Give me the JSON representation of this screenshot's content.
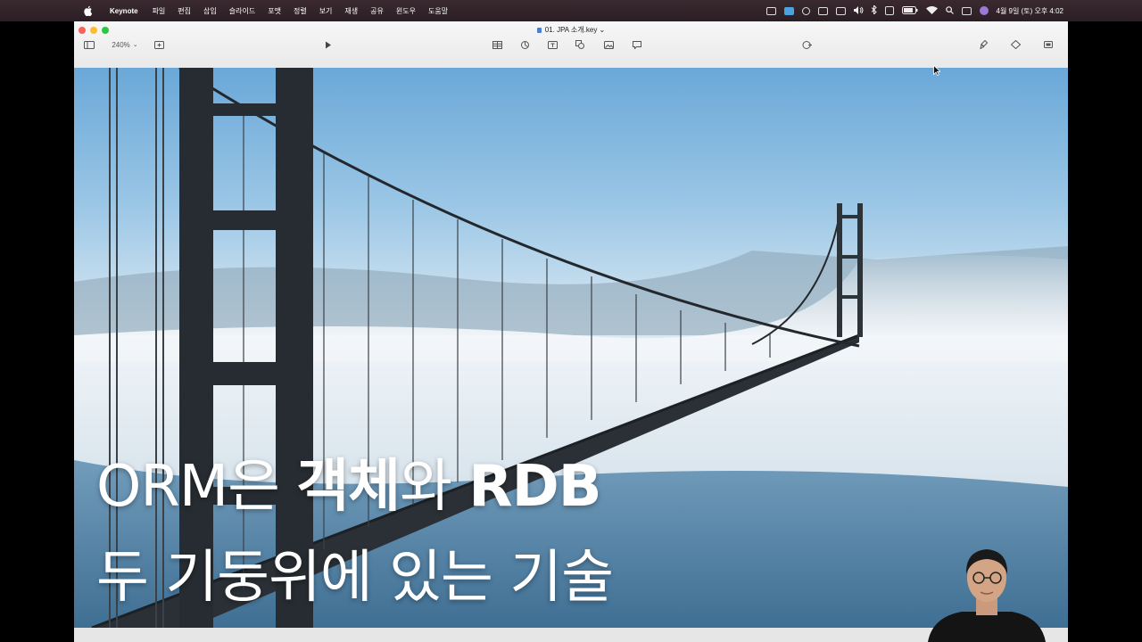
{
  "menubar": {
    "app_name": "Keynote",
    "menus": [
      "파일",
      "편집",
      "삽입",
      "슬라이드",
      "포맷",
      "정렬",
      "보기",
      "재생",
      "공유",
      "윈도우",
      "도움말"
    ],
    "clock": "4월 9일 (토) 오후  4:02"
  },
  "window": {
    "title": "01. JPA 소개.key",
    "zoom": "240%"
  },
  "slide": {
    "line1_a": "ORM은 ",
    "line1_b": "객체",
    "line1_c": "와 ",
    "line1_d": "RDB",
    "line2": "두 기둥위에 있는 기술"
  },
  "colors": {
    "traffic_close": "#ff5f57",
    "traffic_min": "#febc2e",
    "traffic_max": "#28c840",
    "bridge": "#2a3036"
  }
}
